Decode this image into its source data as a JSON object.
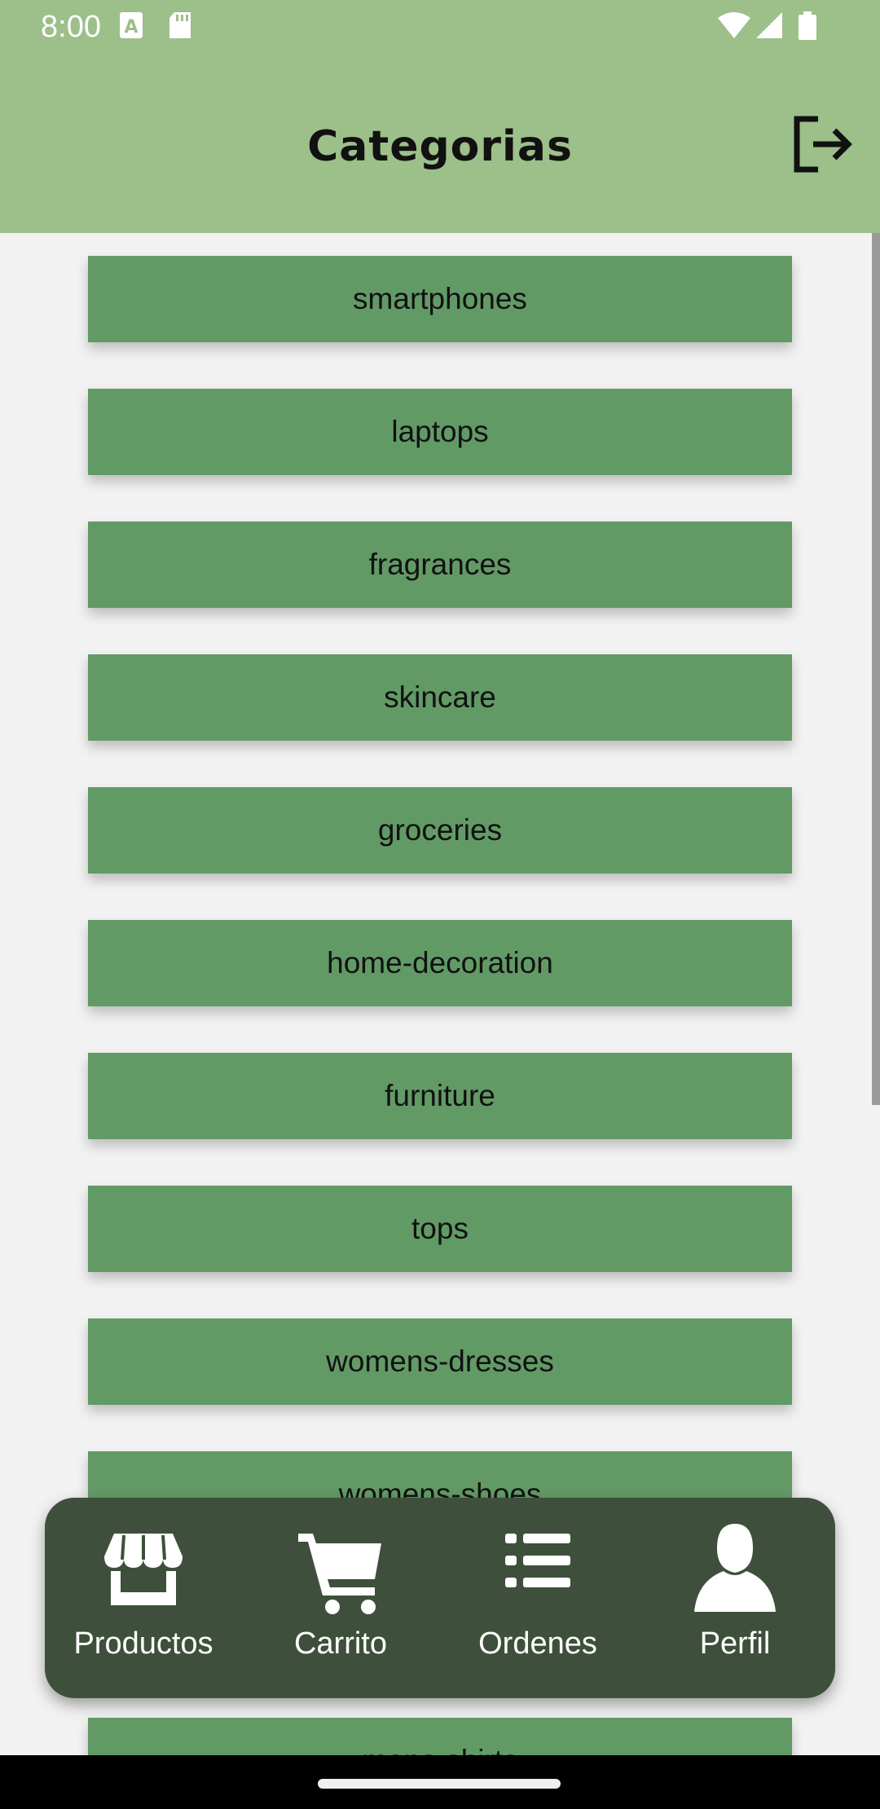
{
  "status_bar": {
    "time": "8:00"
  },
  "header": {
    "title": "Categorias"
  },
  "categories": [
    "smartphones",
    "laptops",
    "fragrances",
    "skincare",
    "groceries",
    "home-decoration",
    "furniture",
    "tops",
    "womens-dresses",
    "womens-shoes",
    "mens-shirts"
  ],
  "bottom_nav": {
    "items": [
      {
        "label": "Productos",
        "icon": "store-icon"
      },
      {
        "label": "Carrito",
        "icon": "cart-icon"
      },
      {
        "label": "Ordenes",
        "icon": "list-icon"
      },
      {
        "label": "Perfil",
        "icon": "person-icon"
      }
    ]
  },
  "colors": {
    "header": "#9dbf8a",
    "category_button": "#629a66",
    "bottom_nav": "#3e503b",
    "background": "#f2f2f2"
  }
}
